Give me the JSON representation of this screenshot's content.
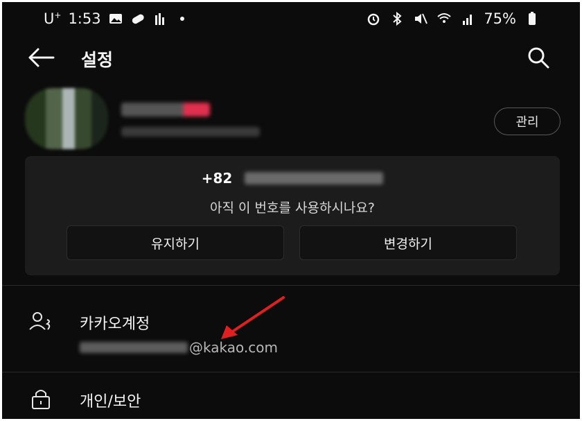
{
  "status_bar": {
    "carrier": "U",
    "carrier_sup": "+",
    "time": "1:53",
    "battery": "75%"
  },
  "header": {
    "title": "설정"
  },
  "profile": {
    "manage_label": "관리"
  },
  "phone_card": {
    "country_code": "+82",
    "question": "아직 이 번호를 사용하시나요?",
    "keep_label": "유지하기",
    "change_label": "변경하기"
  },
  "list": {
    "kakao_account_label": "카카오계정",
    "kakao_account_email_domain": "@kakao.com",
    "privacy_label": "개인/보안"
  },
  "colors": {
    "background": "#0c0c0c",
    "card": "#1c1c1c",
    "annotation_arrow": "#e02020"
  }
}
